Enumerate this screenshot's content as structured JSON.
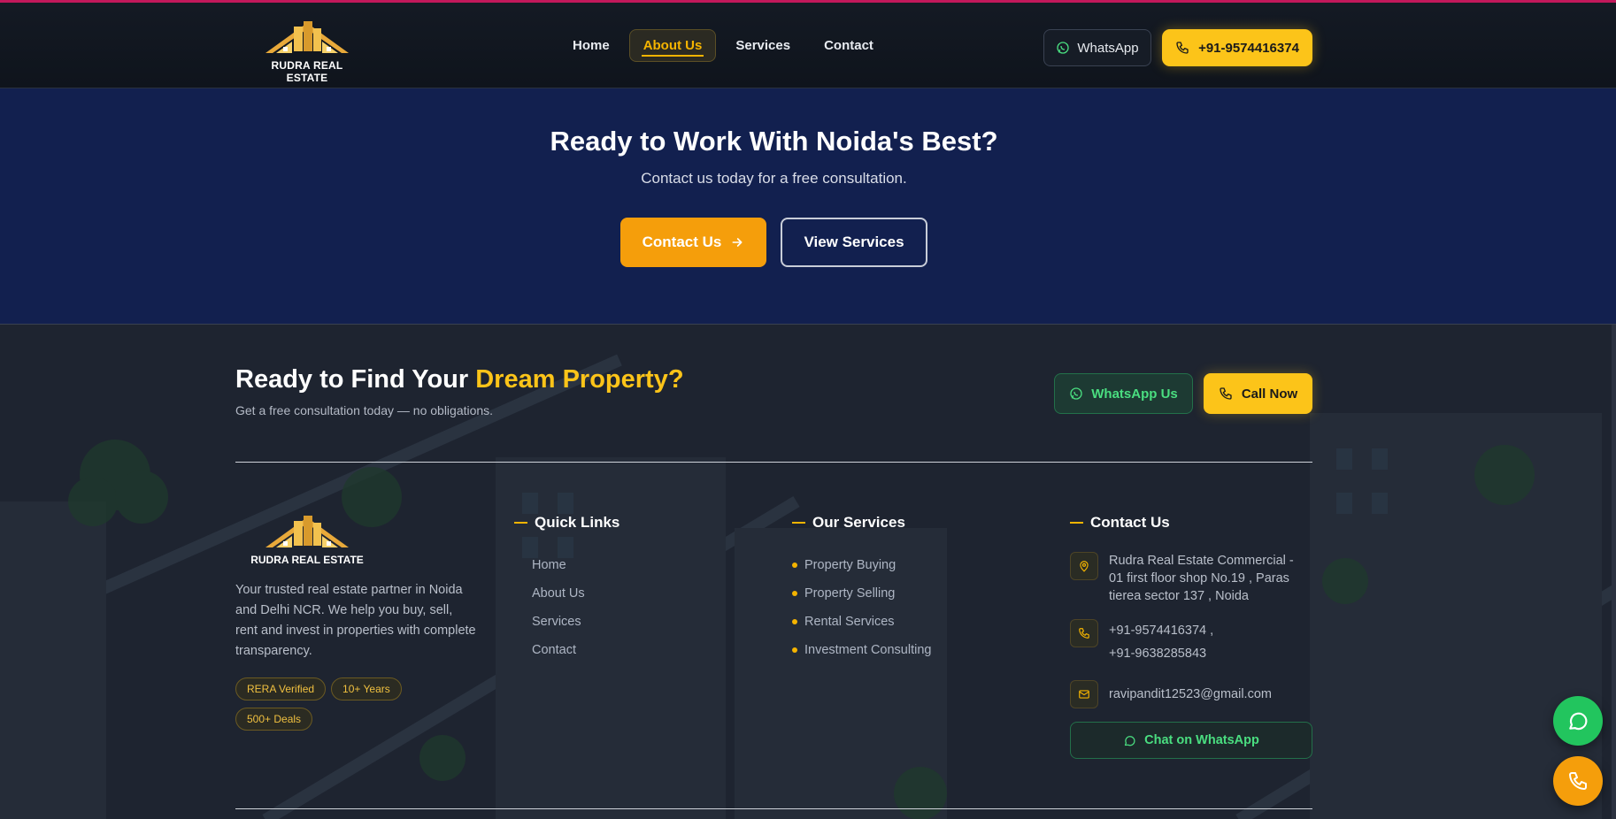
{
  "brand": {
    "name": "RUDRA REAL ESTATE",
    "accent": "#fcc419",
    "accent_orange": "#f59e0b",
    "whatsapp_green": "#22c55e"
  },
  "nav": {
    "items": [
      "Home",
      "About Us",
      "Services",
      "Contact"
    ],
    "active": "About Us"
  },
  "header": {
    "whatsapp_label": "WhatsApp",
    "phone_label": "+91-9574416374",
    "whatsapp_icon": "whatsapp-icon",
    "phone_icon": "phone-icon"
  },
  "cta": {
    "title": "Ready to Work With Noida's Best?",
    "subtitle": "Contact us today for a free consultation.",
    "contact_label": "Contact Us",
    "services_label": "View Services"
  },
  "footer": {
    "title_prefix": "Ready to Find Your ",
    "title_highlight": "Dream Property?",
    "subtitle": "Get a free consultation today — no obligations.",
    "whatsapp_label": "WhatsApp Us",
    "call_label": "Call Now",
    "about": "Your trusted real estate partner in Noida and Delhi NCR. We help you buy, sell, rent and invest in properties with complete transparency.",
    "badges": [
      "RERA Verified",
      "10+ Years",
      "500+ Deals"
    ],
    "quick_links": {
      "heading": "Quick Links",
      "items": [
        "Home",
        "About Us",
        "Services",
        "Contact"
      ]
    },
    "services": {
      "heading": "Our Services",
      "items": [
        "Property Buying",
        "Property Selling",
        "Rental Services",
        "Investment Consulting"
      ]
    },
    "contact": {
      "heading": "Contact Us",
      "address": "Rudra Real Estate Commercial - 01 first floor shop No.19 , Paras tierea sector 137 , Noida",
      "phone_1": "+91-9574416374 ,",
      "phone_2": "+91-9638285843",
      "email": "ravipandit12523@gmail.com",
      "chat_label": "Chat on WhatsApp"
    }
  }
}
